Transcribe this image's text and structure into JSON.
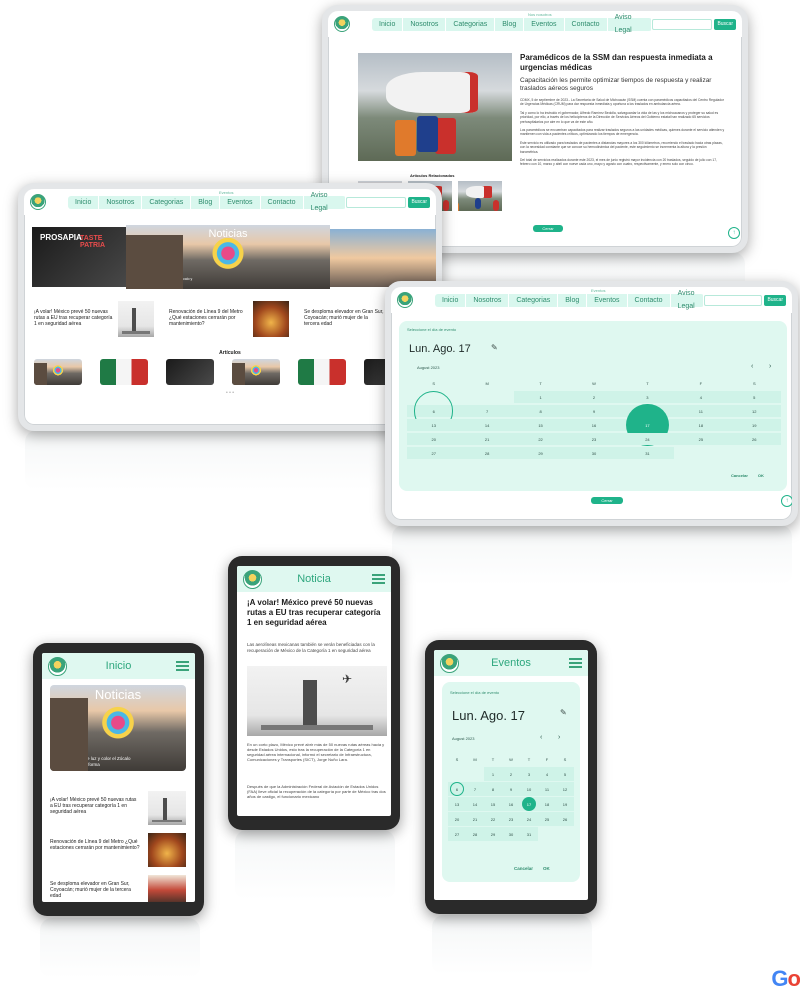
{
  "nav": {
    "links": [
      "Inicio",
      "Nosotros",
      "Categorias",
      "Blog",
      "Eventos",
      "Contacto",
      "Aviso Legal"
    ],
    "search_button": "Buscar",
    "tag_nosotros": "Nos nosotros",
    "tag_eventos": "Eventos",
    "tag_noticias": "Noticias"
  },
  "article": {
    "title": "Paramédicos de la SSM dan respuesta inmediata a urgencias médicas",
    "subtitle": "Capacitación les permite optimizar tiempos de respuesta y realizar traslados aéreos seguros",
    "para1": "CDMX, 5 de septiembre de 2023.- La Secretaría de Salud de Michoacán (SSM) cuenta con paramédicos capacitados del Centro Regulador de Urgencias Médicas (CRUM) para dar respuesta inmediata y oportuna a los traslados en ambulancia aérea.",
    "para2": "Tal y como lo ha instruido el gobernador, Alfredo Ramírez Bedolla, salvaguardar la vida de las y los michoacanos y proteger su salud es prioridad, por ello, a través de los helicópteros de la Dirección de Servicios Aéreos del Gobierno estatal han realizado 65 servicios prehospitalarios por aire en lo que va de este año.",
    "para3": "Los paramédicos se encuentran capacitados para realizar traslados seguros a las unidades médicas, quienes durante el servicio atienden y mantienen con vida a pacientes críticos, optimizando los tiempos de emergencia.",
    "para4": "Este servicio es utilizado para traslados de pacientes a distancias mayores a los 300 kilómetros, recorriendo el traslado hacia otras plazas, con la necesidad constante que se conoce su hemodinámica del paciente, este seguimiento se incrementa la altura y la presión barométrica.",
    "para5": "Del total de servicios realizados durante este 2023, el mes de junio registró mayor incidencia con 20 traslados, seguido de julio con 17, febrero con 10, marzo y abril con nueve cada uno, mayo y agosto con cuatro, respectivamente, y enero solo con cinco.",
    "related_label": "Artículos Relacionados",
    "close_button": "Cerrar"
  },
  "home": {
    "hero_label": "Noticias",
    "hero_badge1": "PROSAPIA",
    "hero_badge2": "TASTE PATRIA",
    "hero_caption": "Gatos llenarán de luz y color el Zócalo y Paseo de la Reforma",
    "news": [
      "¡A volar! México prevé 50 nuevas rutas a EU tras recuperar categoría 1 en seguridad aérea",
      "Renovación de Línea 9 del Metro ¿Qué estaciones cerrarán por mantenimiento?",
      "Se desploma elevador en Gran Sur, Coyoacán; murió mujer de la tercera edad"
    ],
    "articles_label": "Artículos"
  },
  "calendar": {
    "select_label": "Seleccione el día de evento",
    "date": "Lun. Ago. 17",
    "month": "August 2023",
    "weekdays": [
      "S",
      "M",
      "T",
      "W",
      "T",
      "F",
      "S"
    ],
    "days": [
      "",
      "",
      "1",
      "2",
      "3",
      "4",
      "5",
      "6",
      "7",
      "8",
      "9",
      "10",
      "11",
      "12",
      "13",
      "14",
      "15",
      "16",
      "17",
      "18",
      "19",
      "20",
      "21",
      "22",
      "23",
      "24",
      "25",
      "26",
      "27",
      "28",
      "29",
      "30",
      "31",
      "",
      ""
    ],
    "cancel": "Cancelar",
    "ok": "OK",
    "close_button": "Cerrar"
  },
  "mobile": {
    "inicio_title": "Inicio",
    "noticia_title": "Noticia",
    "eventos_title": "Eventos",
    "noticia_headline": "¡A volar! México prevé 50 nuevas rutas a EU tras recuperar categoría 1 en seguridad aérea",
    "noticia_lead": "Las aerolíneas mexicanas también se verán beneficiadas con la recuperación de México de la Categoría 1 en seguridad aérea",
    "noticia_body1": "En un corto plazo, México prevé abrir más de 50 nuevas rutas aéreas hacia y desde Estados Unidos, esto tras la recuperación de la Categoría 1 en seguridad aérea internacional, informó el secretario de Infraestructura, Comunicaciones y Transportes (SICT), Jorge Nuño Lara.",
    "noticia_body2": "Después de que la Administración Federal de Aviación de Estados Unidos (FAA) lleve oficial la recuperación de la categoría por parte de México tras dos años de castigo, el funcionario mexicano"
  },
  "brand": {
    "google_partial": "Go",
    "blue": "#4285F4",
    "red": "#EA4335"
  }
}
